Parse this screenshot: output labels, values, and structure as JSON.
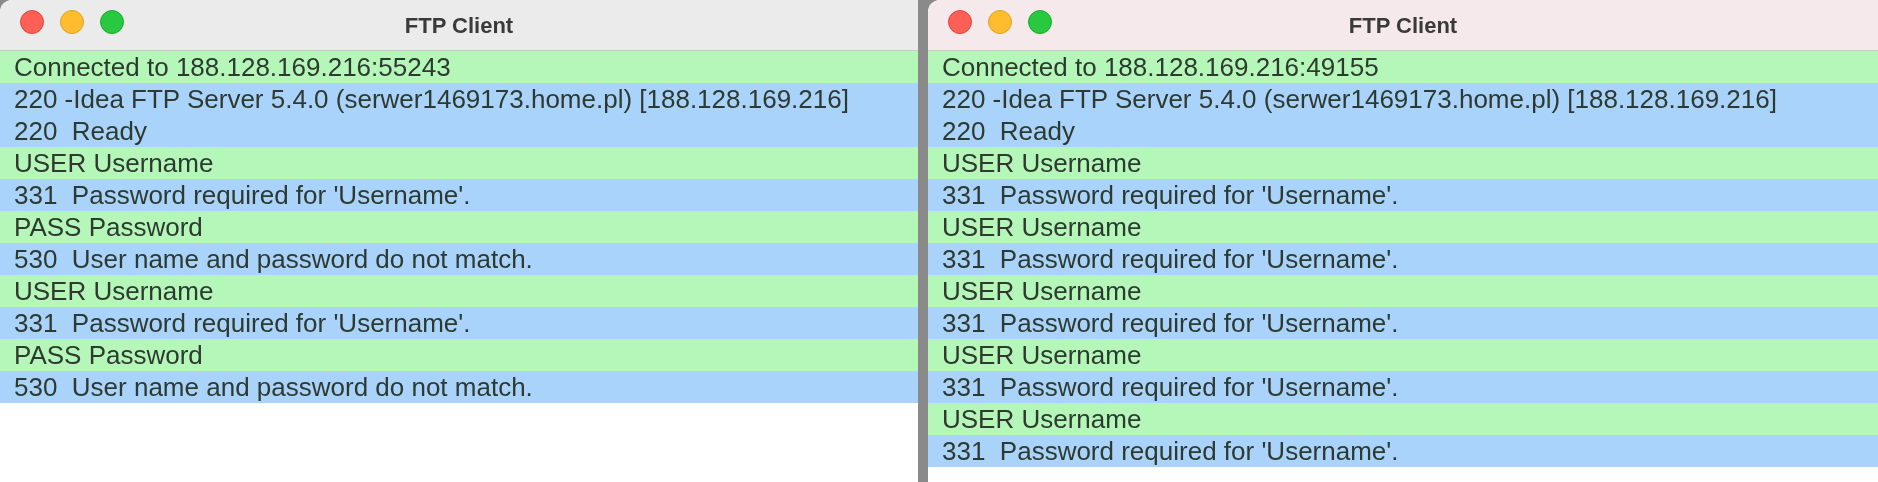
{
  "windows": [
    {
      "title": "FTP Client",
      "lines": [
        {
          "kind": "status",
          "text": "Connected to 188.128.169.216:55243"
        },
        {
          "kind": "reply",
          "text": "220 -Idea FTP Server 5.4.0 (serwer1469173.home.pl) [188.128.169.216]"
        },
        {
          "kind": "reply",
          "text": "220  Ready"
        },
        {
          "kind": "command",
          "text": "USER Username"
        },
        {
          "kind": "reply",
          "text": "331  Password required for 'Username'."
        },
        {
          "kind": "command",
          "text": "PASS Password"
        },
        {
          "kind": "reply",
          "text": "530  User name and password do not match."
        },
        {
          "kind": "command",
          "text": "USER Username"
        },
        {
          "kind": "reply",
          "text": "331  Password required for 'Username'."
        },
        {
          "kind": "command",
          "text": "PASS Password"
        },
        {
          "kind": "reply",
          "text": "530  User name and password do not match."
        }
      ]
    },
    {
      "title": "FTP Client",
      "lines": [
        {
          "kind": "status",
          "text": "Connected to 188.128.169.216:49155"
        },
        {
          "kind": "reply",
          "text": "220 -Idea FTP Server 5.4.0 (serwer1469173.home.pl) [188.128.169.216]"
        },
        {
          "kind": "reply",
          "text": "220  Ready"
        },
        {
          "kind": "command",
          "text": "USER Username"
        },
        {
          "kind": "reply",
          "text": "331  Password required for 'Username'."
        },
        {
          "kind": "command",
          "text": "USER Username"
        },
        {
          "kind": "reply",
          "text": "331  Password required for 'Username'."
        },
        {
          "kind": "command",
          "text": "USER Username"
        },
        {
          "kind": "reply",
          "text": "331  Password required for 'Username'."
        },
        {
          "kind": "command",
          "text": "USER Username"
        },
        {
          "kind": "reply",
          "text": "331  Password required for 'Username'."
        },
        {
          "kind": "command",
          "text": "USER Username"
        },
        {
          "kind": "reply",
          "text": "331  Password required for 'Username'."
        }
      ]
    }
  ]
}
